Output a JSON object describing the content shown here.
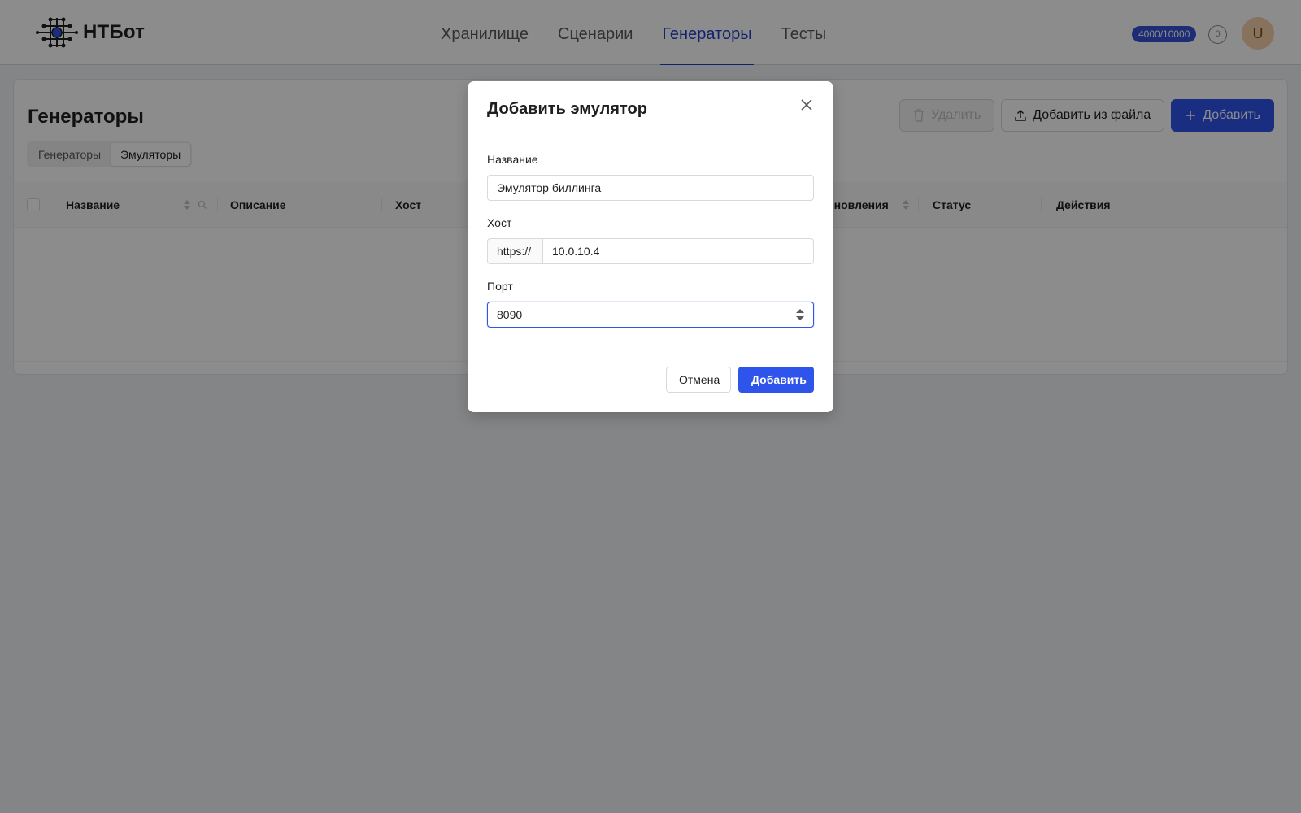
{
  "header": {
    "logo_text": "НТБот",
    "nav": [
      {
        "label": "Хранилище"
      },
      {
        "label": "Сценарии"
      },
      {
        "label": "Генераторы"
      },
      {
        "label": "Тесты"
      }
    ],
    "active_nav": "Генераторы",
    "quota": "4000/10000",
    "notifications": "0",
    "avatar_initial": "U"
  },
  "page": {
    "title": "Генераторы",
    "segments": [
      {
        "label": "Генераторы"
      },
      {
        "label": "Эмуляторы"
      }
    ],
    "active_segment": "Эмуляторы",
    "toolbar": {
      "delete_label": "Удалить",
      "import_label": "Добавить из файла",
      "add_label": "Добавить"
    },
    "table": {
      "columns": [
        {
          "label": "Название"
        },
        {
          "label": "Описание"
        },
        {
          "label": "Хост"
        },
        {
          "label": "бновления"
        },
        {
          "label": "Статус"
        },
        {
          "label": "Действия"
        }
      ]
    }
  },
  "modal": {
    "title": "Добавить эмулятор",
    "fields": {
      "name": {
        "label": "Название",
        "value": "Эмулятор биллинга"
      },
      "host": {
        "label": "Хост",
        "prefix": "https://",
        "value": "10.0.10.4"
      },
      "port": {
        "label": "Порт",
        "value": "8090"
      }
    },
    "cancel_label": "Отмена",
    "ok_label": "Добавить"
  },
  "icons": {
    "logo": "network-logo-icon",
    "trash": "trash-icon",
    "upload": "upload-icon",
    "plus": "plus-icon",
    "close": "close-icon",
    "sort": "sort-icon",
    "search": "search-icon",
    "stepper": "stepper-icon"
  },
  "colors": {
    "accent": "#2f54eb",
    "nav_active": "#1f40c8",
    "avatar_bg": "#f5d0a9"
  }
}
